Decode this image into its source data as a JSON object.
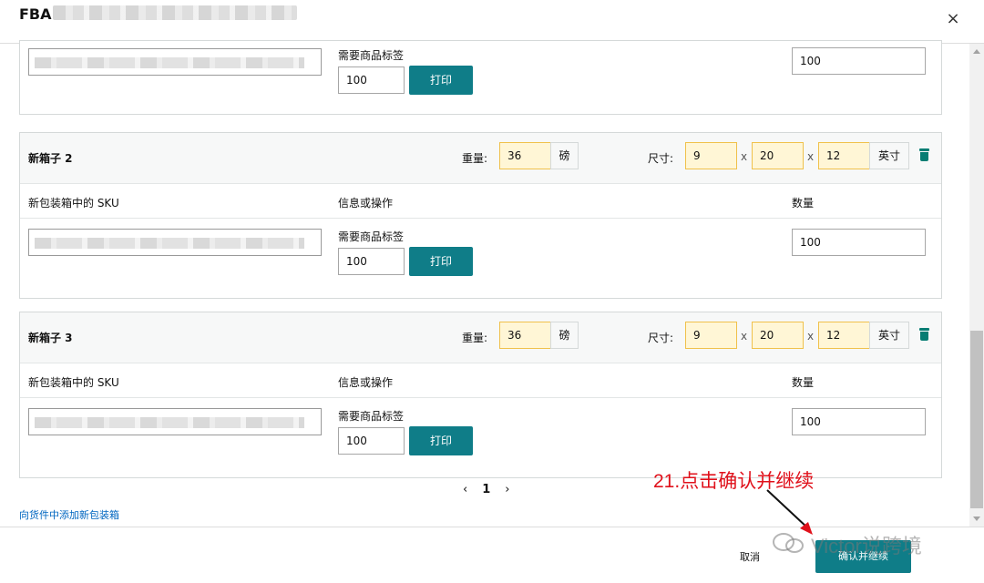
{
  "header": {
    "title": "FBA",
    "close_icon": "×"
  },
  "columns": {
    "sku": "新包装箱中的 SKU",
    "info": "信息或操作",
    "qty": "数量"
  },
  "labels": {
    "weight": "重量:",
    "weight_unit": "磅",
    "dims": "尺寸:",
    "dims_unit": "英寸",
    "times": "x",
    "need_label": "需要商品标签",
    "print": "打印"
  },
  "top_partial": {
    "qty_value": "100",
    "amount_value": "100"
  },
  "boxes": [
    {
      "name": "新箱子 2",
      "weight": "36",
      "dim_l": "9",
      "dim_w": "20",
      "dim_h": "12",
      "qty_value": "100",
      "amount_value": "100"
    },
    {
      "name": "新箱子 3",
      "weight": "36",
      "dim_l": "9",
      "dim_w": "20",
      "dim_h": "12",
      "qty_value": "100",
      "amount_value": "100"
    }
  ],
  "pagination": {
    "prev": "‹",
    "page": "1",
    "next": "›"
  },
  "add_box_link": "向货件中添加新包装箱",
  "footer": {
    "cancel": "取消",
    "confirm": "确认并继续"
  },
  "annotation": "21.点击确认并继续",
  "watermark": "Victor说跨境",
  "colors": {
    "primary": "#0f7d88",
    "highlight_bg": "#fff6d6",
    "highlight_border": "#f0c14b",
    "annotation": "#e0111b"
  }
}
